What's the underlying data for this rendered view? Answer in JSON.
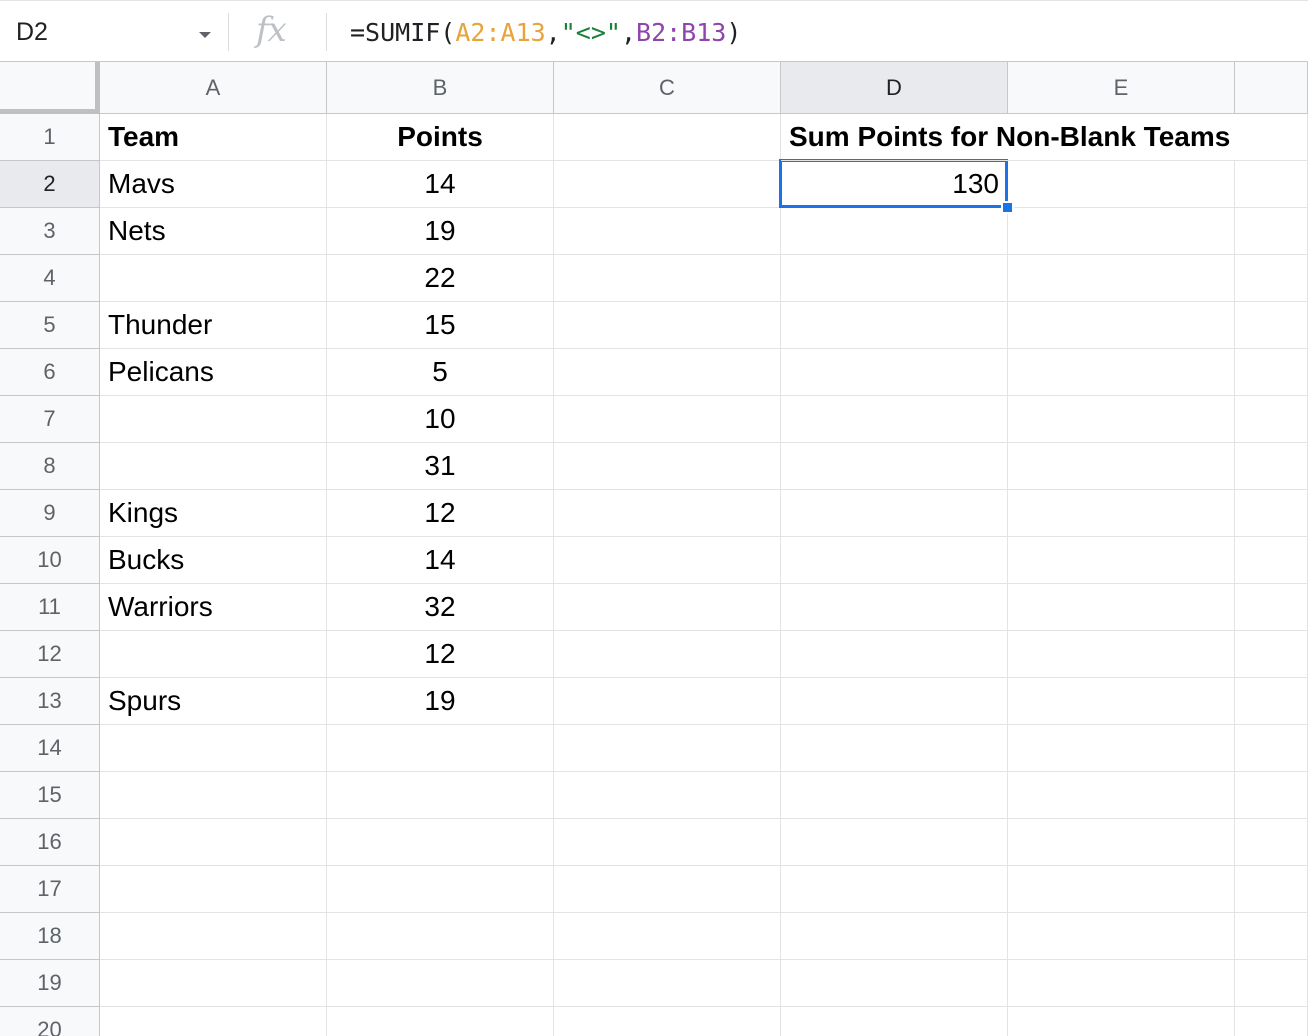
{
  "formula_bar": {
    "name_box": "D2",
    "fx_label": "fx",
    "formula": {
      "prefix": "=SUMIF(",
      "range1": "A2:A13",
      "sep1": ",",
      "criteria": "\"<>\"",
      "sep2": ",",
      "range2": "B2:B13",
      "suffix": ")"
    }
  },
  "columns": [
    "A",
    "B",
    "C",
    "D",
    "E"
  ],
  "rows": [
    "1",
    "2",
    "3",
    "4",
    "5",
    "6",
    "7",
    "8",
    "9",
    "10",
    "11",
    "12",
    "13",
    "14",
    "15",
    "16",
    "17",
    "18",
    "19",
    "20"
  ],
  "header_row": {
    "team": "Team",
    "points": "Points",
    "summary_label": "Sum Points for Non-Blank Teams"
  },
  "summary_value": "130",
  "data": [
    {
      "team": "Mavs",
      "points": "14"
    },
    {
      "team": "Nets",
      "points": "19"
    },
    {
      "team": "",
      "points": "22"
    },
    {
      "team": "Thunder",
      "points": "15"
    },
    {
      "team": "Pelicans",
      "points": "5"
    },
    {
      "team": "",
      "points": "10"
    },
    {
      "team": "",
      "points": "31"
    },
    {
      "team": "Kings",
      "points": "12"
    },
    {
      "team": "Bucks",
      "points": "14"
    },
    {
      "team": "Warriors",
      "points": "32"
    },
    {
      "team": "",
      "points": "12"
    },
    {
      "team": "Spurs",
      "points": "19"
    }
  ],
  "colors": {
    "selection": "#1a73e8",
    "range1": "#e8a33a",
    "criteria": "#188038",
    "range2": "#8e44ad"
  }
}
